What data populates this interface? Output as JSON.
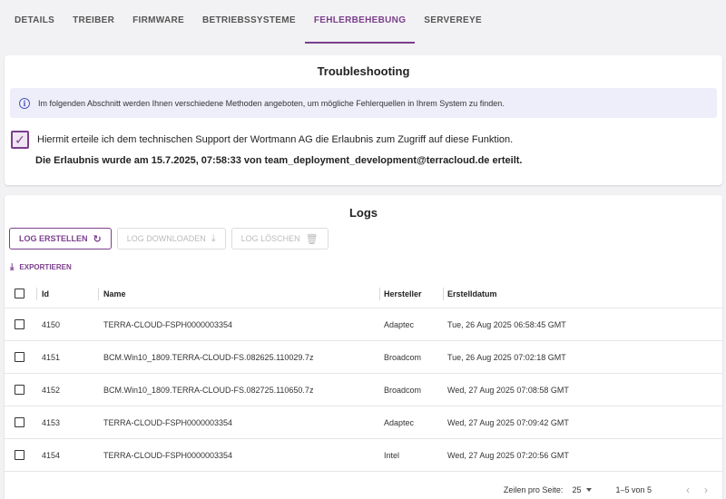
{
  "tabs": [
    {
      "label": "DETAILS"
    },
    {
      "label": "TREIBER"
    },
    {
      "label": "FIRMWARE"
    },
    {
      "label": "BETRIEBSSYSTEME"
    },
    {
      "label": "FEHLERBEHEBUNG"
    },
    {
      "label": "SERVEREYE"
    }
  ],
  "active_tab": "FEHLERBEHEBUNG",
  "troubleshooting": {
    "title": "Troubleshooting",
    "info_text": "Im folgenden Abschnitt werden Ihnen verschiedene Methoden angeboten, um mögliche Fehlerquellen in Ihrem System zu finden.",
    "consent_checked": true,
    "consent_text": "Hiermit erteile ich dem technischen Support der Wortmann AG die Erlaubnis zum Zugriff auf diese Funktion.",
    "permission_info": "Die Erlaubnis wurde am 15.7.2025, 07:58:33 von team_deployment_development@terracloud.de erteilt."
  },
  "logs": {
    "title": "Logs",
    "buttons": {
      "create": "LOG ERSTELLEN",
      "download": "LOG DOWNLOADEN",
      "delete": "LOG LÖSCHEN"
    },
    "export_label": "EXPORTIEREN",
    "columns": {
      "id": "Id",
      "name": "Name",
      "manufacturer": "Hersteller",
      "created": "Erstelldatum"
    },
    "rows": [
      {
        "id": "4150",
        "name": "TERRA-CLOUD-FSPH0000003354",
        "manufacturer": "Adaptec",
        "created": "Tue, 26 Aug 2025 06:58:45 GMT"
      },
      {
        "id": "4151",
        "name": "BCM.Win10_1809.TERRA-CLOUD-FS.082625.110029.7z",
        "manufacturer": "Broadcom",
        "created": "Tue, 26 Aug 2025 07:02:18 GMT"
      },
      {
        "id": "4152",
        "name": "BCM.Win10_1809.TERRA-CLOUD-FS.082725.110650.7z",
        "manufacturer": "Broadcom",
        "created": "Wed, 27 Aug 2025 07:08:58 GMT"
      },
      {
        "id": "4153",
        "name": "TERRA-CLOUD-FSPH0000003354",
        "manufacturer": "Adaptec",
        "created": "Wed, 27 Aug 2025 07:09:42 GMT"
      },
      {
        "id": "4154",
        "name": "TERRA-CLOUD-FSPH0000003354",
        "manufacturer": "Intel",
        "created": "Wed, 27 Aug 2025 07:20:56 GMT"
      }
    ],
    "pagination": {
      "rows_per_page_label": "Zeilen pro Seite:",
      "rows_per_page": "25",
      "range": "1–5 von 5"
    }
  },
  "colors": {
    "accent": "#7b3f8c",
    "info_bg": "#eeeefa",
    "info_icon": "#4e55b8"
  },
  "icons": {
    "info": "info-circle-icon",
    "refresh": "refresh-icon",
    "download": "download-icon",
    "trash": "trash-icon",
    "export": "export-icon",
    "check": "check-icon",
    "prev": "chevron-left-icon",
    "next": "chevron-right-icon"
  }
}
